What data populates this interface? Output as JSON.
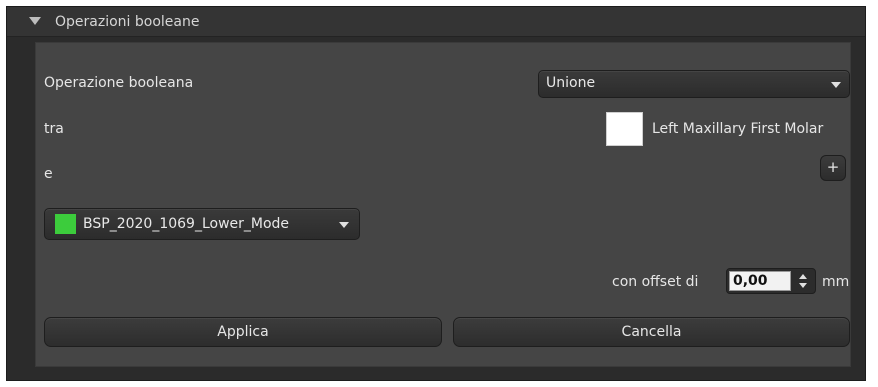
{
  "panel": {
    "title": "Operazioni booleane"
  },
  "form": {
    "operation_label": "Operazione booleana",
    "operation_value": "Unione",
    "between_label": "tra",
    "first_object_name": "Left Maxillary First Molar",
    "first_object_color": "#ffffff",
    "and_label": "e",
    "add_symbol": "+",
    "second_object_name": "BSP_2020_1069_Lower_Mode",
    "second_object_color": "#3ccc3c",
    "offset_label": "con offset di",
    "offset_value": "0,00",
    "offset_unit": "mm"
  },
  "buttons": {
    "apply_label": "Applica",
    "cancel_label": "Cancella"
  },
  "icons": {
    "collapse": "triangle-down-icon",
    "dropdown": "chevron-down-icon",
    "add": "plus-icon",
    "spin_up": "spin-up-icon",
    "spin_down": "spin-down-icon"
  }
}
